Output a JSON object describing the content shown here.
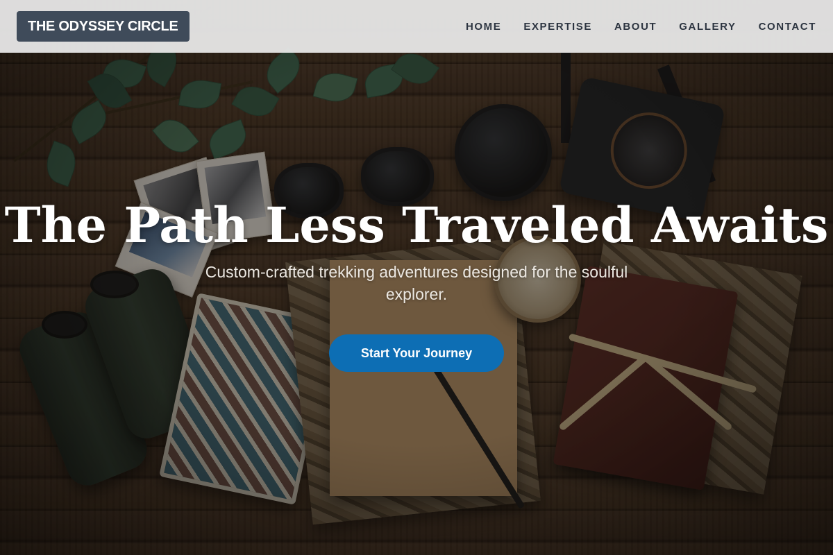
{
  "brand": {
    "logo_text": "THE ODYSSEY CIRCLE"
  },
  "nav": {
    "items": [
      {
        "label": "HOME"
      },
      {
        "label": "EXPERTISE"
      },
      {
        "label": "ABOUT"
      },
      {
        "label": "GALLERY"
      },
      {
        "label": "CONTACT"
      }
    ]
  },
  "hero": {
    "title": "The Path Less Traveled Awaits",
    "subtitle": "Custom-crafted trekking adventures designed for the soulful explorer.",
    "cta_label": "Start Your Journey",
    "background": "flat-lay of travel gear on wooden table"
  },
  "colors": {
    "header_bg": "#ececec",
    "logo_bg": "#3f4b5a",
    "nav_text": "#2c3440",
    "cta_bg": "#0d6eb4",
    "hero_text": "#ffffff"
  }
}
